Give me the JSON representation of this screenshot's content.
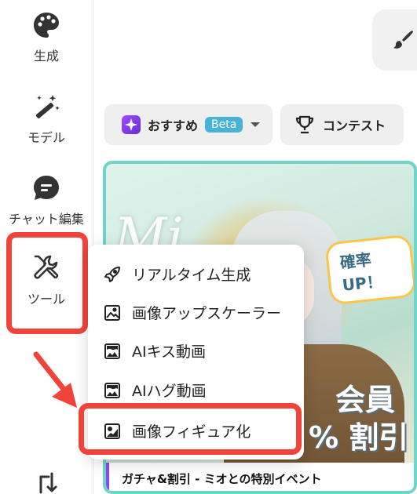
{
  "sidebar": {
    "items": [
      {
        "label": "生成",
        "icon": "palette-icon"
      },
      {
        "label": "モデル",
        "icon": "magic-wand-icon"
      },
      {
        "label": "チャット編集",
        "icon": "chat-bubble-icon"
      },
      {
        "label": "ツール",
        "icon": "tools-icon"
      }
    ],
    "bottom_icon": "sort-arrow-icon"
  },
  "tabs": {
    "recommend_label": "おすすめ",
    "beta_badge": "Beta",
    "contest_label": "コンテスト"
  },
  "banner": {
    "script_text": "Mi",
    "speech_text": "確率 UP！",
    "member_text": "会員",
    "discount_text": "% 割引",
    "caption": "ガチャ&割引 - ミオとの特別イベント"
  },
  "tool_menu": {
    "items": [
      {
        "label": "リアルタイム生成",
        "icon": "rocket-icon"
      },
      {
        "label": "画像アップスケーラー",
        "icon": "image-icon"
      },
      {
        "label": "AIキス動画",
        "icon": "kiss-video-icon"
      },
      {
        "label": "AIハグ動画",
        "icon": "hug-video-icon"
      },
      {
        "label": "画像フィギュア化",
        "icon": "figure-image-icon"
      }
    ]
  },
  "colors": {
    "highlight": "#f0443b",
    "beta": "#48b3d8",
    "accent_purple": "#8b47ff"
  }
}
